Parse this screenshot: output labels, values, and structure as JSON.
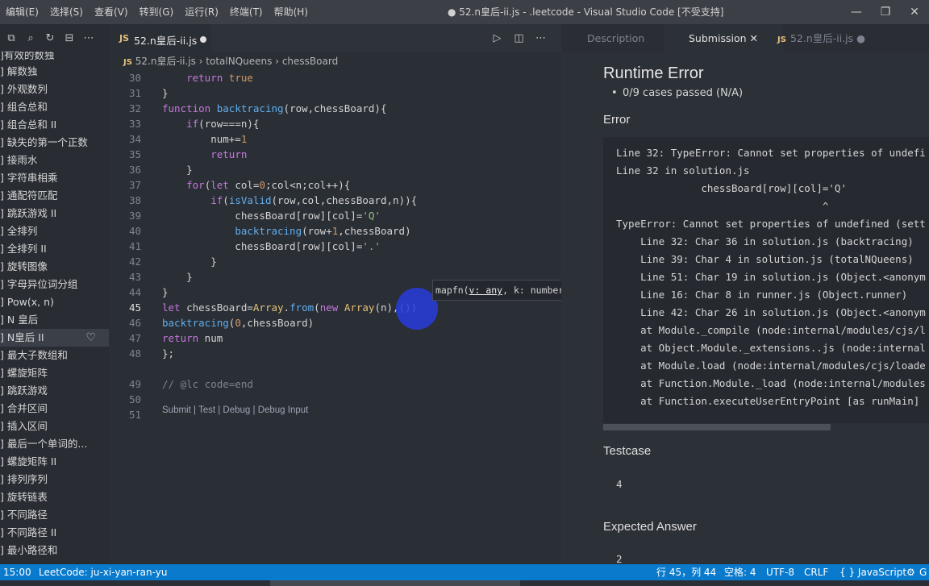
{
  "menu": [
    "编辑(E)",
    "选择(S)",
    "查看(V)",
    "转到(G)",
    "运行(R)",
    "终端(T)",
    "帮助(H)"
  ],
  "window_title": "● 52.n皇后-ii.js - .leetcode - Visual Studio Code [不受支持]",
  "window_controls": [
    "—",
    "❐",
    "✕"
  ],
  "sidebar": {
    "tools": [
      "⧉",
      "⌕",
      "↻",
      "⊟",
      "⋯"
    ],
    "partial_top": "有效的数独",
    "items": [
      {
        "label": "解数独"
      },
      {
        "label": "外观数列"
      },
      {
        "label": "组合总和"
      },
      {
        "label": "组合总和 II"
      },
      {
        "label": "缺失的第一个正数"
      },
      {
        "label": "接雨水"
      },
      {
        "label": "字符串相乘"
      },
      {
        "label": "通配符匹配"
      },
      {
        "label": "跳跃游戏 II"
      },
      {
        "label": "全排列"
      },
      {
        "label": "全排列 II"
      },
      {
        "label": "旋转图像"
      },
      {
        "label": "字母异位词分组"
      },
      {
        "label": "Pow(x, n)"
      },
      {
        "label": "N 皇后"
      },
      {
        "label": "N皇后 II",
        "active": true
      },
      {
        "label": "最大子数组和"
      },
      {
        "label": "螺旋矩阵"
      },
      {
        "label": "跳跃游戏"
      },
      {
        "label": "合并区间"
      },
      {
        "label": "插入区间"
      },
      {
        "label": "最后一个单词的..."
      },
      {
        "label": "螺旋矩阵 II"
      },
      {
        "label": "排列序列"
      },
      {
        "label": "旋转链表"
      },
      {
        "label": "不同路径"
      },
      {
        "label": "不同路径 II"
      },
      {
        "label": "最小路径和"
      }
    ],
    "heart_icon": "♡"
  },
  "editor": {
    "tab": {
      "lang": "JS",
      "name": "52.n皇后-ii.js"
    },
    "actions": [
      "▷",
      "◫",
      "⋯"
    ],
    "breadcrumb": {
      "file": "52.n皇后-ii.js",
      "fn": "totalNQueens",
      "var": "chessBoard"
    },
    "lines": [
      {
        "n": "30",
        "html": "        <span class='kw'>return</span> <span class='num'>true</span>"
      },
      {
        "n": "31",
        "html": "    }"
      },
      {
        "n": "32",
        "html": "    <span class='kw'>function</span> <span class='fn'>backtracing</span>(row,chessBoard){"
      },
      {
        "n": "33",
        "html": "        <span class='kw'>if</span>(row===n){"
      },
      {
        "n": "34",
        "html": "            num+=<span class='num'>1</span>"
      },
      {
        "n": "35",
        "html": "            <span class='kw'>return</span>"
      },
      {
        "n": "36",
        "html": "        }"
      },
      {
        "n": "37",
        "html": "        <span class='kw'>for</span>(<span class='kw'>let</span> col=<span class='num'>0</span>;col&lt;n;col++){"
      },
      {
        "n": "38",
        "html": "            <span class='kw'>if</span>(<span class='fn'>isValid</span>(row,col,chessBoard,n)){"
      },
      {
        "n": "39",
        "html": "                chessBoard[row][col]=<span class='str'>'Q'</span>"
      },
      {
        "n": "40",
        "html": "                <span class='fn'>backtracing</span>(row+<span class='num'>1</span>,chessBoard)"
      },
      {
        "n": "41",
        "html": "                chessBoard[row][col]=<span class='str'>'.'</span>"
      },
      {
        "n": "42",
        "html": "            }"
      },
      {
        "n": "43",
        "html": "        }"
      },
      {
        "n": "44",
        "html": "    }"
      },
      {
        "n": "45",
        "html": "    <span class='kw'>let</span> chessBoard=<span class='cls'>Array</span>.<span class='fn'>from</span>(<span class='kw'>new</span> <span class='cls'>Array</span>(n),())",
        "current": true
      },
      {
        "n": "46",
        "html": "    <span class='fn'>backtracing</span>(<span class='num'>0</span>,chessBoard)"
      },
      {
        "n": "47",
        "html": "    <span class='kw'>return</span> num"
      },
      {
        "n": "48",
        "html": "};"
      },
      {
        "n": "49",
        "html": "<span class='cm'>// @lc code=end</span>",
        "gap": true
      },
      {
        "n": "50",
        "html": ""
      },
      {
        "n": "51",
        "html": ""
      }
    ],
    "codelens": "Submit | Test | Debug | Debug Input",
    "hover": {
      "pre": "mapfn(",
      "param": "v: any",
      "post": ", k: number): any"
    }
  },
  "panel": {
    "tabs": [
      {
        "label": "Description",
        "state": "dim"
      },
      {
        "label": "Submission",
        "state": "active",
        "close": "✕"
      },
      {
        "label": "52.n皇后-ii.js",
        "state": "dim",
        "lang": "JS",
        "dot": "●"
      }
    ],
    "title": "Runtime Error",
    "cases": "0/9 cases passed (N/A)",
    "error_heading": "Error",
    "error_lines": [
      "Line 32: TypeError: Cannot set properties of undefi",
      "Line 32 in solution.js",
      "              chessBoard[row][col]='Q'",
      "                                  ^",
      "TypeError: Cannot set properties of undefined (sett",
      "    Line 32: Char 36 in solution.js (backtracing)",
      "    Line 39: Char 4 in solution.js (totalNQueens)",
      "    Line 51: Char 19 in solution.js (Object.<anonym",
      "    Line 16: Char 8 in runner.js (Object.runner)",
      "    Line 42: Char 26 in solution.js (Object.<anonym",
      "    at Module._compile (node:internal/modules/cjs/l",
      "    at Object.Module._extensions..js (node:internal",
      "    at Module.load (node:internal/modules/cjs/loade",
      "    at Function.Module._load (node:internal/modules",
      "    at Function.executeUserEntryPoint [as runMain]"
    ],
    "testcase_heading": "Testcase",
    "testcase_value": "4",
    "expected_heading": "Expected Answer",
    "expected_value": "2"
  },
  "statusbar": {
    "left_time": "15:00",
    "account": "LeetCode: ju-xi-yan-ran-yu",
    "position": "行 45，列 44",
    "spaces": "空格: 4",
    "encoding": "UTF-8",
    "eol": "CRLF",
    "language": "{ } JavaScript",
    "sync_icon": "⚙",
    "last": "G"
  }
}
